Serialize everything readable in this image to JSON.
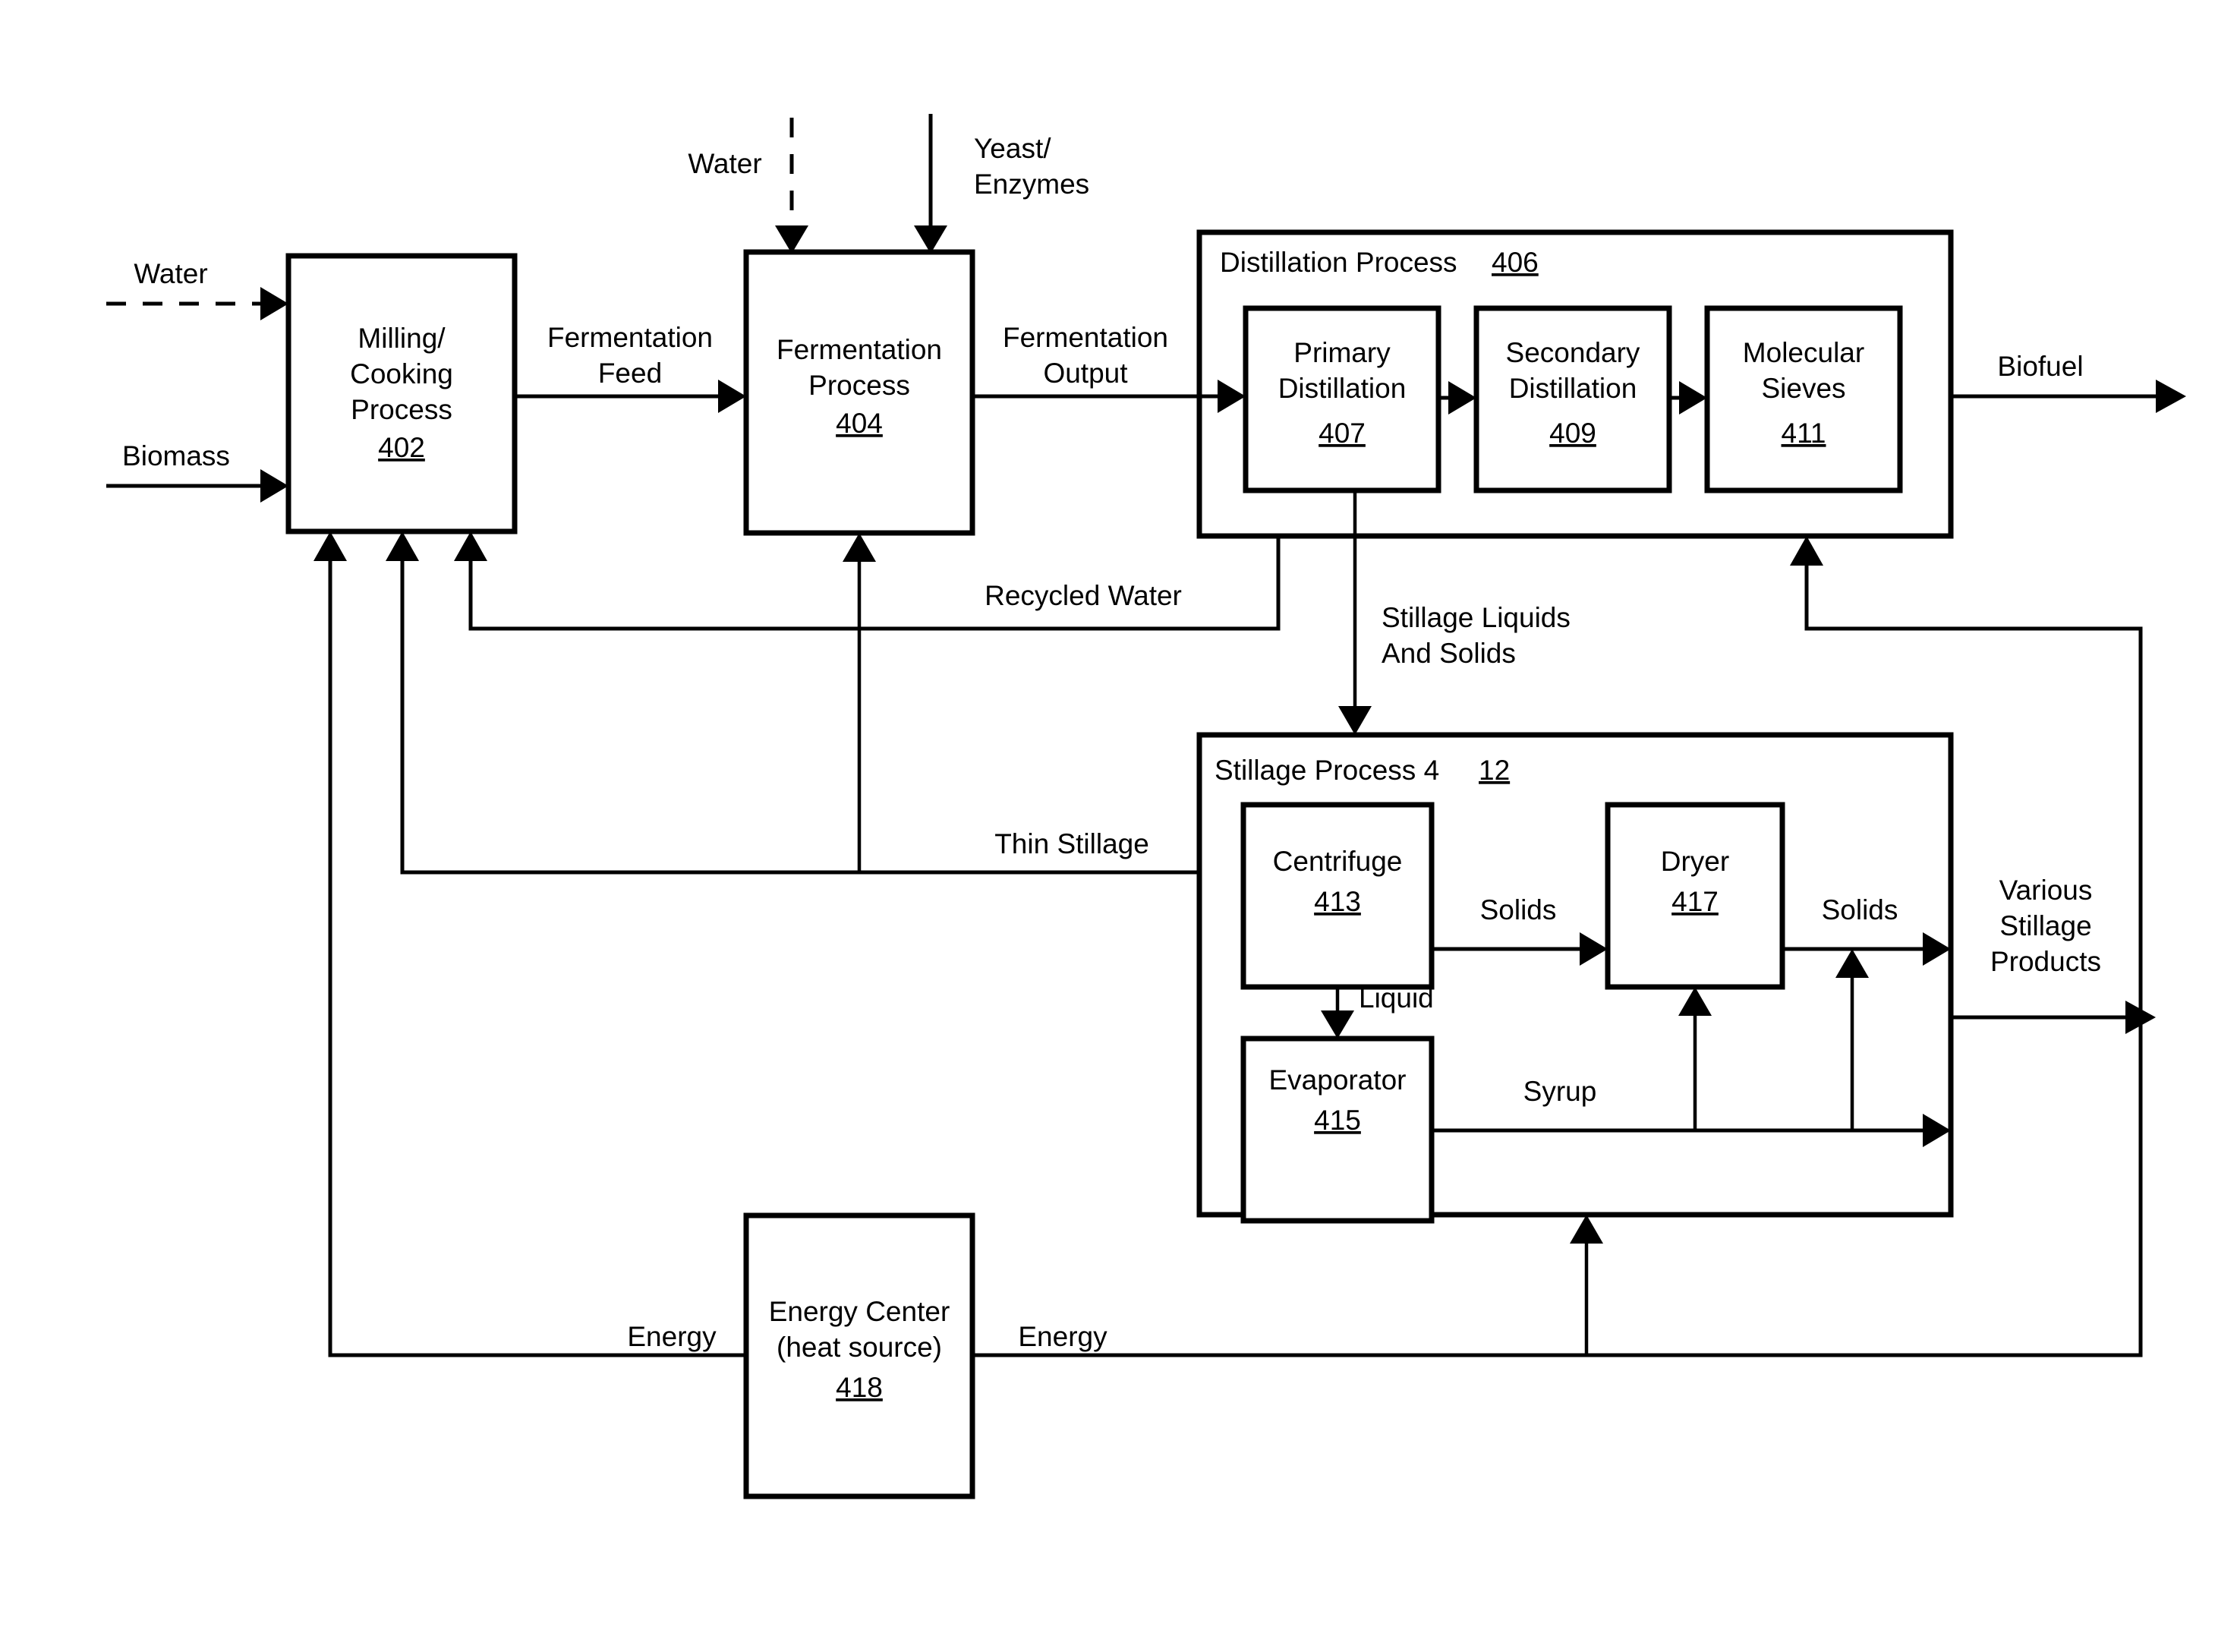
{
  "diagram": {
    "title": "Biofuel Production Process Flow Diagram",
    "boxes": {
      "milling": {
        "line1": "Milling/",
        "line2": "Cooking",
        "line3": "Process",
        "ref": "402"
      },
      "fermentation": {
        "line1": "Fermentation",
        "line2": "Process",
        "ref": "404"
      },
      "distillation_group": {
        "label": "Distillation Process",
        "ref": "406"
      },
      "primary_distillation": {
        "line1": "Primary",
        "line2": "Distillation",
        "ref": "407"
      },
      "secondary_distillation": {
        "line1": "Secondary",
        "line2": "Distillation",
        "ref": "409"
      },
      "molecular_sieves": {
        "line1": "Molecular",
        "line2": "Sieves",
        "ref": "411"
      },
      "stillage_group": {
        "label": "Stillage Process 4",
        "ref": "12"
      },
      "centrifuge": {
        "line1": "Centrifuge",
        "ref": "413"
      },
      "evaporator": {
        "line1": "Evaporator",
        "ref": "415"
      },
      "dryer": {
        "line1": "Dryer",
        "ref": "417"
      },
      "energy_center": {
        "line1": "Energy Center",
        "line2": "(heat source)",
        "ref": "418"
      }
    },
    "flow_labels": {
      "water_in": "Water",
      "biomass_in": "Biomass",
      "water_ferm": "Water",
      "yeast_enzymes_line1": "Yeast/",
      "yeast_enzymes_line2": "Enzymes",
      "fermentation_feed_line1": "Fermentation",
      "fermentation_feed_line2": "Feed",
      "fermentation_output_line1": "Fermentation",
      "fermentation_output_line2": "Output",
      "biofuel_out": "Biofuel",
      "recycled_water": "Recycled Water",
      "stillage_liquids_line1": "Stillage Liquids",
      "stillage_liquids_line2": "And Solids",
      "thin_stillage": "Thin Stillage",
      "solids_centrifuge": "Solids",
      "solids_dryer": "Solids",
      "liquid": "Liquid",
      "syrup": "Syrup",
      "various_line1": "Various",
      "various_line2": "Stillage",
      "various_line3": "Products",
      "energy_left": "Energy",
      "energy_right": "Energy"
    },
    "colors": {
      "stroke": "#000000",
      "fill": "#ffffff"
    }
  }
}
